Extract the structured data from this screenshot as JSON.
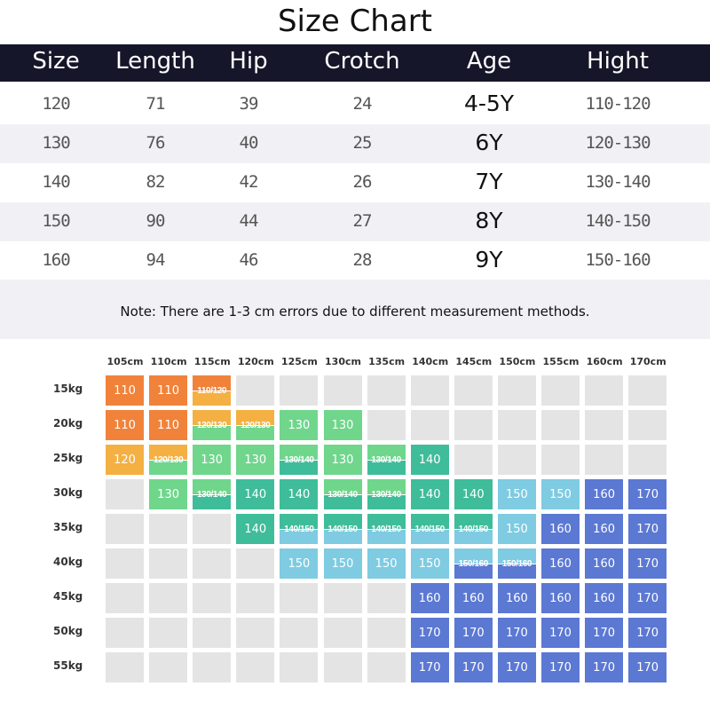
{
  "title": "Size Chart",
  "table": {
    "headers": [
      "Size",
      "Length",
      "Hip",
      "Crotch",
      "Age",
      "Hight"
    ],
    "rows": [
      [
        "120",
        "71",
        "39",
        "24",
        "4-5Y",
        "110-120"
      ],
      [
        "130",
        "76",
        "40",
        "25",
        "6Y",
        "120-130"
      ],
      [
        "140",
        "82",
        "42",
        "26",
        "7Y",
        "130-140"
      ],
      [
        "150",
        "90",
        "44",
        "27",
        "8Y",
        "140-150"
      ],
      [
        "160",
        "94",
        "46",
        "28",
        "9Y",
        "150-160"
      ]
    ]
  },
  "note": "Note: There are 1-3 cm errors due to different measurement methods.",
  "grid": {
    "heights": [
      "105cm",
      "110cm",
      "115cm",
      "120cm",
      "125cm",
      "130cm",
      "135cm",
      "140cm",
      "145cm",
      "150cm",
      "155cm",
      "160cm",
      "170cm"
    ],
    "weights": [
      "15kg",
      "20kg",
      "25kg",
      "30kg",
      "35kg",
      "40kg",
      "45kg",
      "50kg",
      "55kg"
    ],
    "cells": [
      [
        "110",
        "110",
        "110/120",
        "",
        "",
        "",
        "",
        "",
        "",
        "",
        "",
        "",
        ""
      ],
      [
        "110",
        "110",
        "120/130",
        "120/130",
        "130",
        "130",
        "",
        "",
        "",
        "",
        "",
        "",
        ""
      ],
      [
        "120",
        "120/130",
        "130",
        "130",
        "130/140",
        "130",
        "130/140",
        "140",
        "",
        "",
        "",
        "",
        ""
      ],
      [
        "",
        "130",
        "130/140",
        "140",
        "140",
        "130/140",
        "130/140",
        "140",
        "140",
        "150",
        "150",
        "160",
        "170"
      ],
      [
        "",
        "",
        "",
        "140",
        "140/150",
        "140/150",
        "140/150",
        "140/150",
        "140/150",
        "150",
        "160",
        "160",
        "170"
      ],
      [
        "",
        "",
        "",
        "",
        "150",
        "150",
        "150",
        "150",
        "150/160",
        "150/160",
        "160",
        "160",
        "170"
      ],
      [
        "",
        "",
        "",
        "",
        "",
        "",
        "",
        "160",
        "160",
        "160",
        "160",
        "160",
        "170"
      ],
      [
        "",
        "",
        "",
        "",
        "",
        "",
        "",
        "170",
        "170",
        "170",
        "170",
        "170",
        "170"
      ],
      [
        "",
        "",
        "",
        "",
        "",
        "",
        "",
        "170",
        "170",
        "170",
        "170",
        "170",
        "170"
      ]
    ],
    "colors": {
      "110": "#f0823a",
      "120": "#f4b043",
      "130": "#6fd68c",
      "140": "#3fbc9a",
      "150": "#7ecbe2",
      "160": "#5b78d3",
      "170": "#5b78d3",
      "empty": "#e4e4e4"
    }
  }
}
